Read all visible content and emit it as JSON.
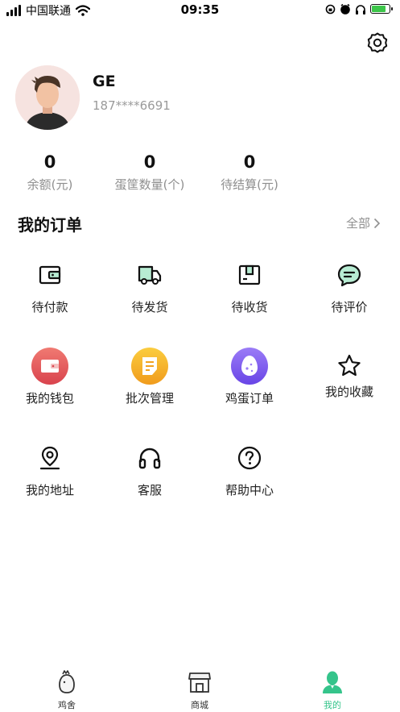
{
  "status_bar": {
    "carrier": "中国联通",
    "time": "09:35",
    "battery_level": 0.8
  },
  "colors": {
    "accent": "#35c48b",
    "wallet_red": "#e0555a",
    "batch_orange": "#f4b62f",
    "egg_purple": "#7a5cf0"
  },
  "profile": {
    "name": "GE",
    "phone": "187****6691"
  },
  "stats": [
    {
      "value": "0",
      "label": "余额(元)"
    },
    {
      "value": "0",
      "label": "蛋筐数量(个)"
    },
    {
      "value": "0",
      "label": "待结算(元)"
    }
  ],
  "orders": {
    "title": "我的订单",
    "view_all": "全部",
    "items": [
      {
        "label": "待付款",
        "icon": "wallet-outline-icon"
      },
      {
        "label": "待发货",
        "icon": "truck-icon"
      },
      {
        "label": "待收货",
        "icon": "box-icon"
      },
      {
        "label": "待评价",
        "icon": "comment-icon"
      }
    ]
  },
  "services": [
    {
      "label": "我的钱包",
      "icon": "wallet-icon"
    },
    {
      "label": "批次管理",
      "icon": "batch-icon"
    },
    {
      "label": "鸡蛋订单",
      "icon": "egg-icon"
    },
    {
      "label": "我的收藏",
      "icon": "star-icon"
    },
    {
      "label": "我的地址",
      "icon": "location-icon"
    },
    {
      "label": "客服",
      "icon": "headset-icon"
    },
    {
      "label": "帮助中心",
      "icon": "help-icon"
    }
  ],
  "tabs": [
    {
      "label": "鸡舍",
      "icon": "coop-icon"
    },
    {
      "label": "商城",
      "icon": "store-icon"
    },
    {
      "label": "我的",
      "icon": "profile-icon",
      "active": true
    }
  ]
}
